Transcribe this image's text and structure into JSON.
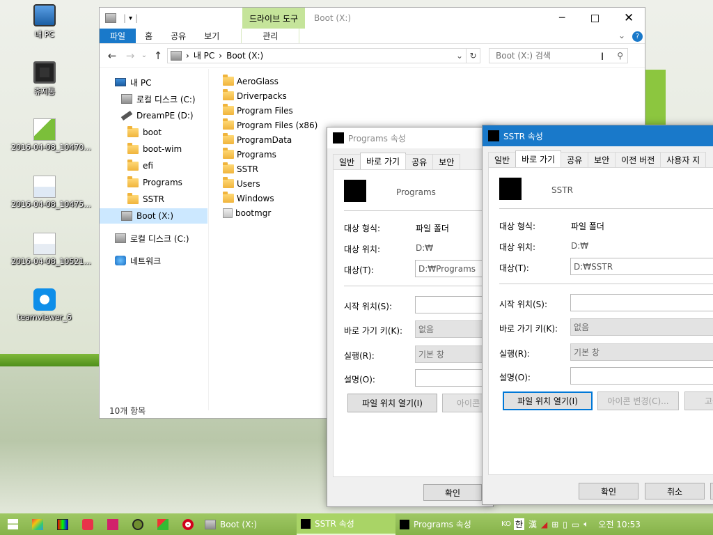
{
  "desktop": {
    "icons": [
      {
        "label": "내 PC",
        "icon": "computer-icon"
      },
      {
        "label": "휴지통",
        "icon": "recycle-bin-icon"
      },
      {
        "label": "2016-04-08_10470...",
        "icon": "image-file-icon"
      },
      {
        "label": "2016-04-08_10475...",
        "icon": "image-file-icon"
      },
      {
        "label": "2016-04-08_10521...",
        "icon": "image-file-icon"
      },
      {
        "label": "teamviewer_6",
        "icon": "teamviewer-icon"
      }
    ]
  },
  "explorer": {
    "title": "Boot (X:)",
    "context_tab_group": "드라이브 도구",
    "ribbon_tabs": [
      "파일",
      "홈",
      "공유",
      "보기"
    ],
    "context_tab": "관리",
    "breadcrumb": [
      "내 PC",
      "Boot (X:)"
    ],
    "search_placeholder": "Boot (X:) 검색",
    "nav": {
      "my_pc": "내 PC",
      "local_c": "로컬 디스크 (C:)",
      "dreampe": "DreamPE (D:)",
      "d_children": [
        "boot",
        "boot-wim",
        "efi",
        "Programs",
        "SSTR"
      ],
      "boot_x": "Boot (X:)",
      "local_c2": "로컬 디스크 (C:)",
      "network": "네트워크"
    },
    "files": [
      "AeroGlass",
      "Driverpacks",
      "Program Files",
      "Program Files (x86)",
      "ProgramData",
      "Programs",
      "SSTR",
      "Users",
      "Windows",
      "bootmgr"
    ],
    "status": "10개 항목"
  },
  "dlg_programs": {
    "title": "Programs 속성",
    "tabs": [
      "일반",
      "바로 가기",
      "공유",
      "보안"
    ],
    "name": "Programs",
    "target_type_label": "대상 형식:",
    "target_type": "파일 폴더",
    "target_loc_label": "대상 위치:",
    "target_loc": "D:₩",
    "target_label": "대상(T):",
    "target": "D:₩Programs",
    "start_label": "시작 위치(S):",
    "hotkey_label": "바로 가기 키(K):",
    "hotkey": "없음",
    "run_label": "실행(R):",
    "run": "기본 창",
    "comment_label": "설명(O):",
    "open_location": "파일 위치 열기(I)",
    "change_icon": "아이콘 변",
    "ok": "확인"
  },
  "dlg_sstr": {
    "title": "SSTR 속성",
    "tabs": [
      "일반",
      "바로 가기",
      "공유",
      "보안",
      "이전 버전",
      "사용자 지"
    ],
    "name": "SSTR",
    "target_type_label": "대상 형식:",
    "target_type": "파일 폴더",
    "target_loc_label": "대상 위치:",
    "target_loc": "D:₩",
    "target_label": "대상(T):",
    "target": "D:₩SSTR",
    "start_label": "시작 위치(S):",
    "hotkey_label": "바로 가기 키(K):",
    "hotkey": "없음",
    "run_label": "실행(R):",
    "run": "기본 창",
    "comment_label": "설명(O):",
    "open_location": "파일 위치 열기(I)",
    "change_icon": "아이콘 변경(C)...",
    "advanced": "고급",
    "ok": "확인",
    "cancel": "취소"
  },
  "taskbar": {
    "apps": [
      "Boot (X:)",
      "SSTR 속성",
      "Programs 속성"
    ],
    "ime_lang": "KO",
    "ime_mode": "한",
    "clock": "오전 10:53"
  },
  "colors": {
    "accent": "#1979ca",
    "taskbar": "#8fbb52",
    "context_tab": "#c5e49a"
  }
}
